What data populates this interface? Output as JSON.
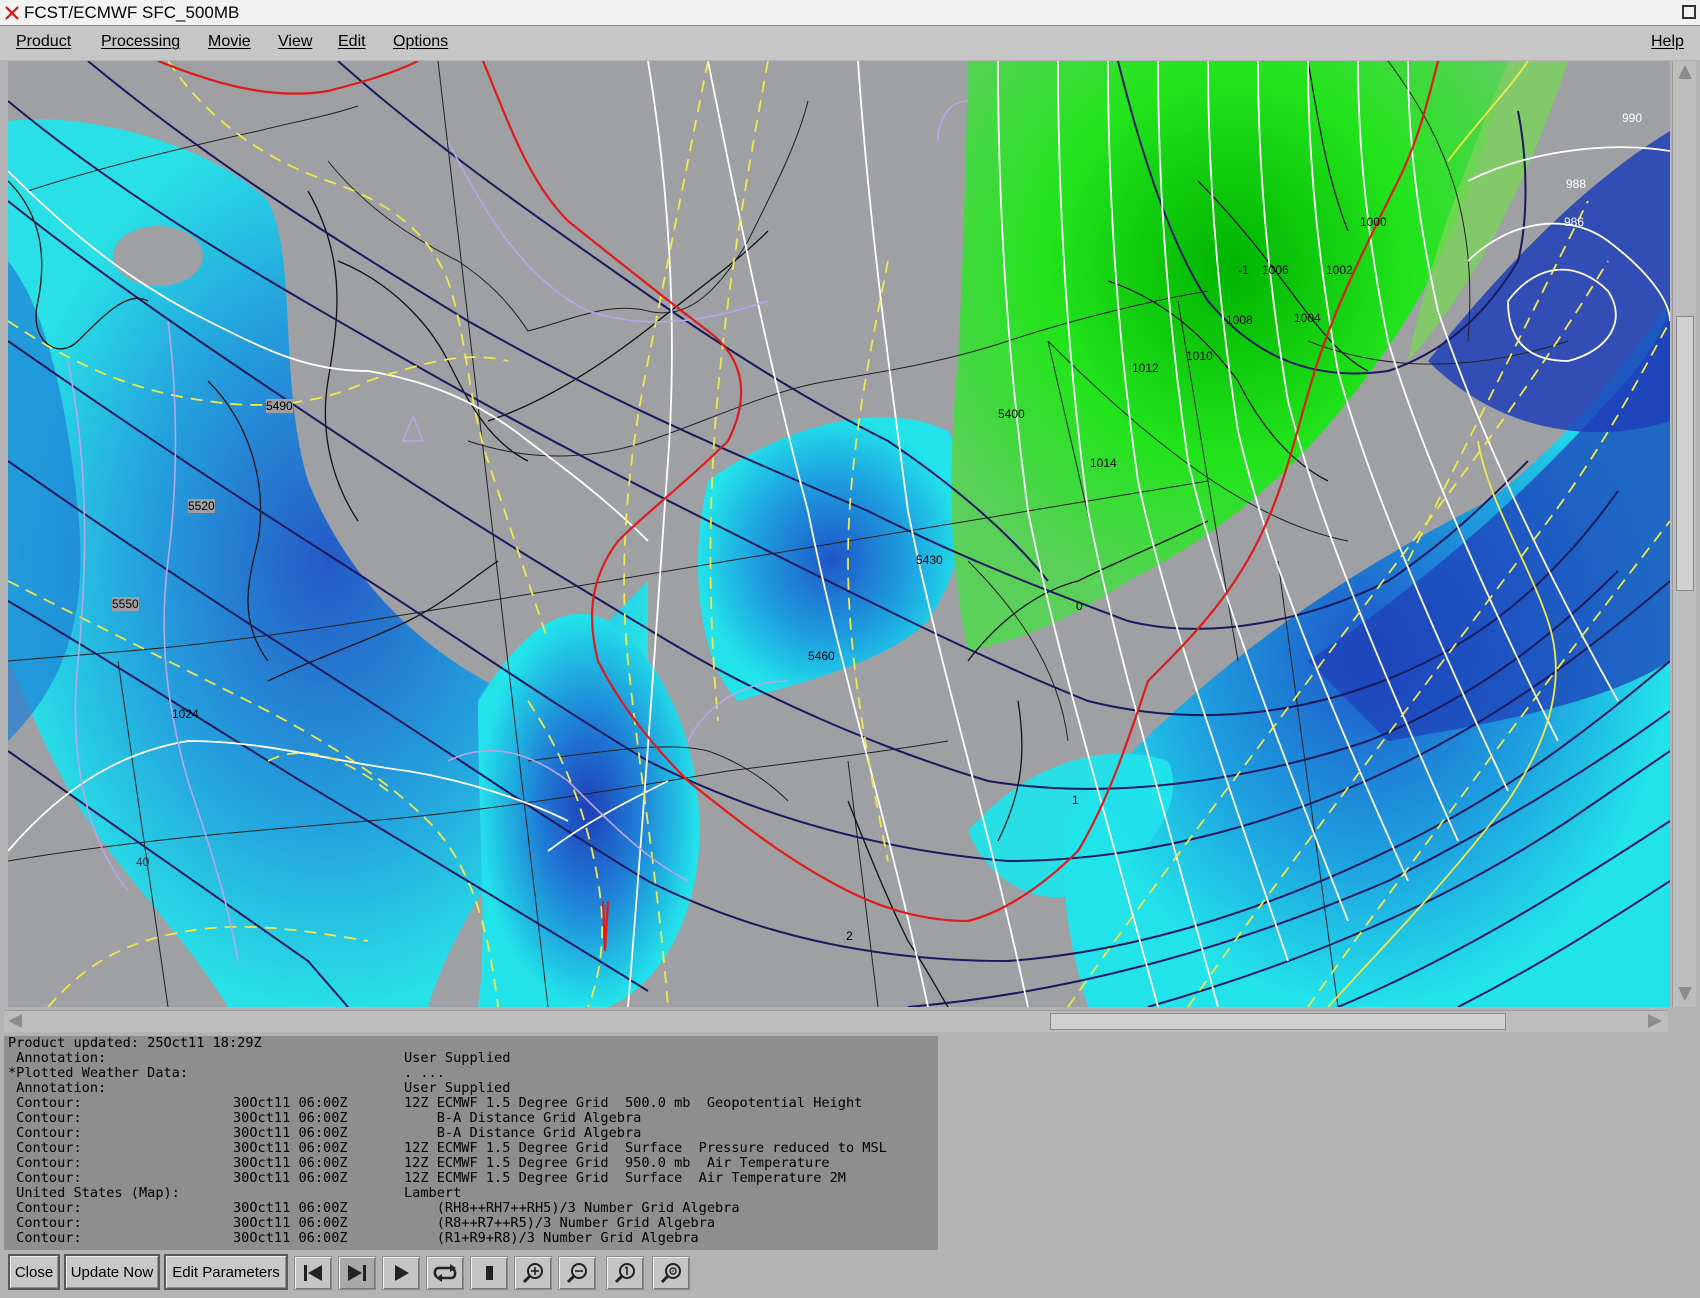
{
  "window": {
    "title": "FCST/ECMWF SFC_500MB"
  },
  "menu": {
    "product": "Product",
    "processing": "Processing",
    "movie": "Movie",
    "view": "View",
    "edit": "Edit",
    "options": "Options",
    "help": "Help"
  },
  "map": {
    "height_labels": [
      "5490",
      "5520",
      "5550",
      "5400",
      "5430",
      "5460"
    ],
    "pressure_labels": [
      "1024",
      "1014",
      "1012",
      "1010",
      "1008",
      "1006",
      "1004",
      "1002",
      "1000",
      "990",
      "988",
      "986"
    ],
    "temperature_labels": [
      "-1",
      "0",
      "1",
      "2",
      "40"
    ]
  },
  "info": {
    "updated": "Product updated: 25Oct11 18:29Z",
    "rows": [
      {
        "col1": " Annotation:",
        "col2": "",
        "col3": "User Supplied"
      },
      {
        "col1": "*Plotted Weather Data:",
        "col2": "",
        "col3": ". ..."
      },
      {
        "col1": " Annotation:",
        "col2": "",
        "col3": "User Supplied"
      },
      {
        "col1": " Contour:",
        "col2": "30Oct11 06:00Z",
        "col3": "12Z ECMWF 1.5 Degree Grid  500.0 mb  Geopotential Height"
      },
      {
        "col1": " Contour:",
        "col2": "30Oct11 06:00Z",
        "col3": "    B-A Distance Grid Algebra"
      },
      {
        "col1": " Contour:",
        "col2": "30Oct11 06:00Z",
        "col3": "    B-A Distance Grid Algebra"
      },
      {
        "col1": " Contour:",
        "col2": "30Oct11 06:00Z",
        "col3": "12Z ECMWF 1.5 Degree Grid  Surface  Pressure reduced to MSL"
      },
      {
        "col1": " Contour:",
        "col2": "30Oct11 06:00Z",
        "col3": "12Z ECMWF 1.5 Degree Grid  950.0 mb  Air Temperature"
      },
      {
        "col1": " Contour:",
        "col2": "30Oct11 06:00Z",
        "col3": "12Z ECMWF 1.5 Degree Grid  Surface  Air Temperature 2M"
      },
      {
        "col1": " United States (Map):",
        "col2": "",
        "col3": "Lambert"
      },
      {
        "col1": " Contour:",
        "col2": "30Oct11 06:00Z",
        "col3": "    (RH8++RH7++RH5)/3 Number Grid Algebra"
      },
      {
        "col1": " Contour:",
        "col2": "30Oct11 06:00Z",
        "col3": "    (R8++R7++R5)/3 Number Grid Algebra"
      },
      {
        "col1": " Contour:",
        "col2": "30Oct11 06:00Z",
        "col3": "    (R1+R9+R8)/3 Number Grid Algebra"
      }
    ]
  },
  "toolbar": {
    "close": "Close",
    "update_now": "Update Now",
    "edit_parameters": "Edit Parameters"
  },
  "colors": {
    "height_contour": "#1a1a5e",
    "pressure_contour": "#ffffff",
    "temperature_dashed": "#f2e84a",
    "freezing_line": "#e01b1b",
    "humidity_light": "#22e3ea",
    "humidity_dark": "#1f56c8",
    "precip_green": "#16c816"
  }
}
